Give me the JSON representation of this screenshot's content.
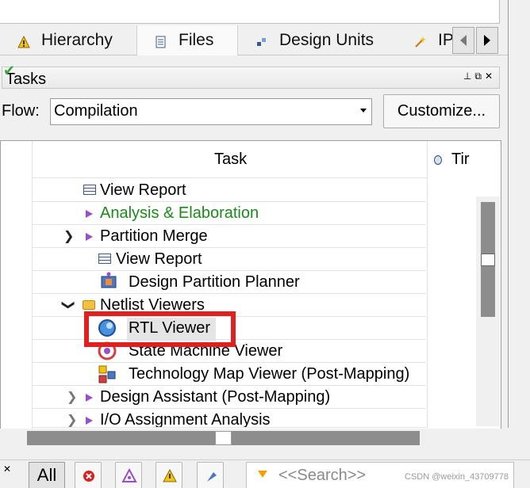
{
  "tabs": [
    {
      "label": "Hierarchy",
      "icon": "hierarchy-warning-icon"
    },
    {
      "label": "Files",
      "icon": "file-icon"
    },
    {
      "label": "Design Units",
      "icon": "design-units-icon"
    },
    {
      "label": "IP",
      "icon": "ip-icon"
    }
  ],
  "tasks_panel": {
    "title": "Tasks"
  },
  "flow": {
    "label": "Flow:",
    "value": "Compilation",
    "customize_label": "Customize..."
  },
  "table": {
    "headers": {
      "task": "Task",
      "time": "Tir"
    },
    "rows": [
      {
        "label": "View Report",
        "icon": "report-icon",
        "status": ""
      },
      {
        "label": "Analysis & Elaboration",
        "icon": "run-icon",
        "status": "done",
        "color": "#1a8a1a"
      },
      {
        "label": "Partition Merge",
        "icon": "run-icon",
        "status": "",
        "expanded": true
      },
      {
        "label": "View Report",
        "icon": "report-icon",
        "status": ""
      },
      {
        "label": "Design Partition Planner",
        "icon": "partition-planner-icon",
        "status": ""
      },
      {
        "label": "Netlist Viewers",
        "icon": "folder-icon",
        "status": "",
        "expanded": true
      },
      {
        "label": "RTL Viewer",
        "icon": "rtl-viewer-icon",
        "status": "",
        "selected": true
      },
      {
        "label": "State Machine Viewer",
        "icon": "state-machine-icon",
        "status": ""
      },
      {
        "label": "Technology Map Viewer (Post-Mapping)",
        "icon": "tech-map-icon",
        "status": ""
      },
      {
        "label": "Design Assistant (Post-Mapping)",
        "icon": "run-icon",
        "status": "",
        "expanded": false
      },
      {
        "label": "I/O Assignment Analysis",
        "icon": "run-icon",
        "status": "",
        "expanded": false
      }
    ]
  },
  "bottom_bar": {
    "all_label": "All",
    "search_placeholder": "<<Search>>"
  },
  "watermark": "CSDN @weixin_43709778",
  "colors": {
    "highlight": "#e01f1f",
    "accent_purple": "#9b4dca",
    "done_green": "#1a8a1a"
  }
}
